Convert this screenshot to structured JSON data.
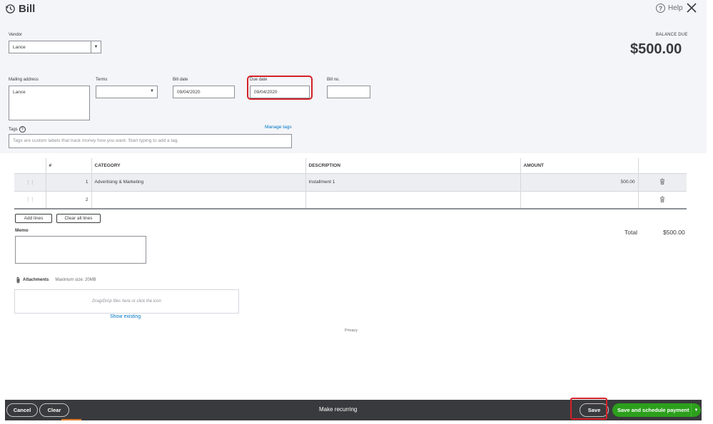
{
  "window": {
    "title": "Bill",
    "help_label": "Help"
  },
  "header": {
    "vendor_label": "Vendor",
    "vendor_value": "Lance",
    "balance_due_label": "BALANCE DUE",
    "balance_due_value": "$500.00",
    "mailing_address_label": "Mailing address",
    "mailing_address_value": "Lance",
    "terms_label": "Terms",
    "terms_value": "",
    "bill_date_label": "Bill date",
    "bill_date_value": "09/04/2020",
    "due_date_label": "Due date",
    "due_date_value": "09/04/2020",
    "bill_no_label": "Bill no.",
    "bill_no_value": "",
    "tags_label": "Tags",
    "manage_tags_label": "Manage tags",
    "tags_placeholder": "Tags are custom labels that track money how you want. Start typing to add a tag."
  },
  "table": {
    "columns": {
      "num": "#",
      "category": "CATEGORY",
      "description": "DESCRIPTION",
      "amount": "AMOUNT"
    },
    "rows": [
      {
        "num": "1",
        "category": "Advertising & Marketing",
        "description": "Installment 1",
        "amount": "500.00"
      },
      {
        "num": "2",
        "category": "",
        "description": "",
        "amount": ""
      }
    ]
  },
  "actions": {
    "add_lines": "Add lines",
    "clear_all_lines": "Clear all lines"
  },
  "totals": {
    "label": "Total",
    "value": "$500.00"
  },
  "memo": {
    "label": "Memo"
  },
  "attachments": {
    "label": "Attachments",
    "max_size": "Maximum size: 20MB",
    "dropzone_text": "Drag/Drop files here or click the icon",
    "show_existing": "Show existing"
  },
  "privacy": "Privacy",
  "footer": {
    "cancel": "Cancel",
    "clear": "Clear",
    "make_recurring": "Make recurring",
    "save": "Save",
    "save_and_schedule": "Save and schedule payment"
  },
  "colors": {
    "accent_green": "#2ca01c",
    "footer_bg": "#393a3d",
    "highlight_red": "#d32128",
    "link_blue": "#0077c5"
  }
}
